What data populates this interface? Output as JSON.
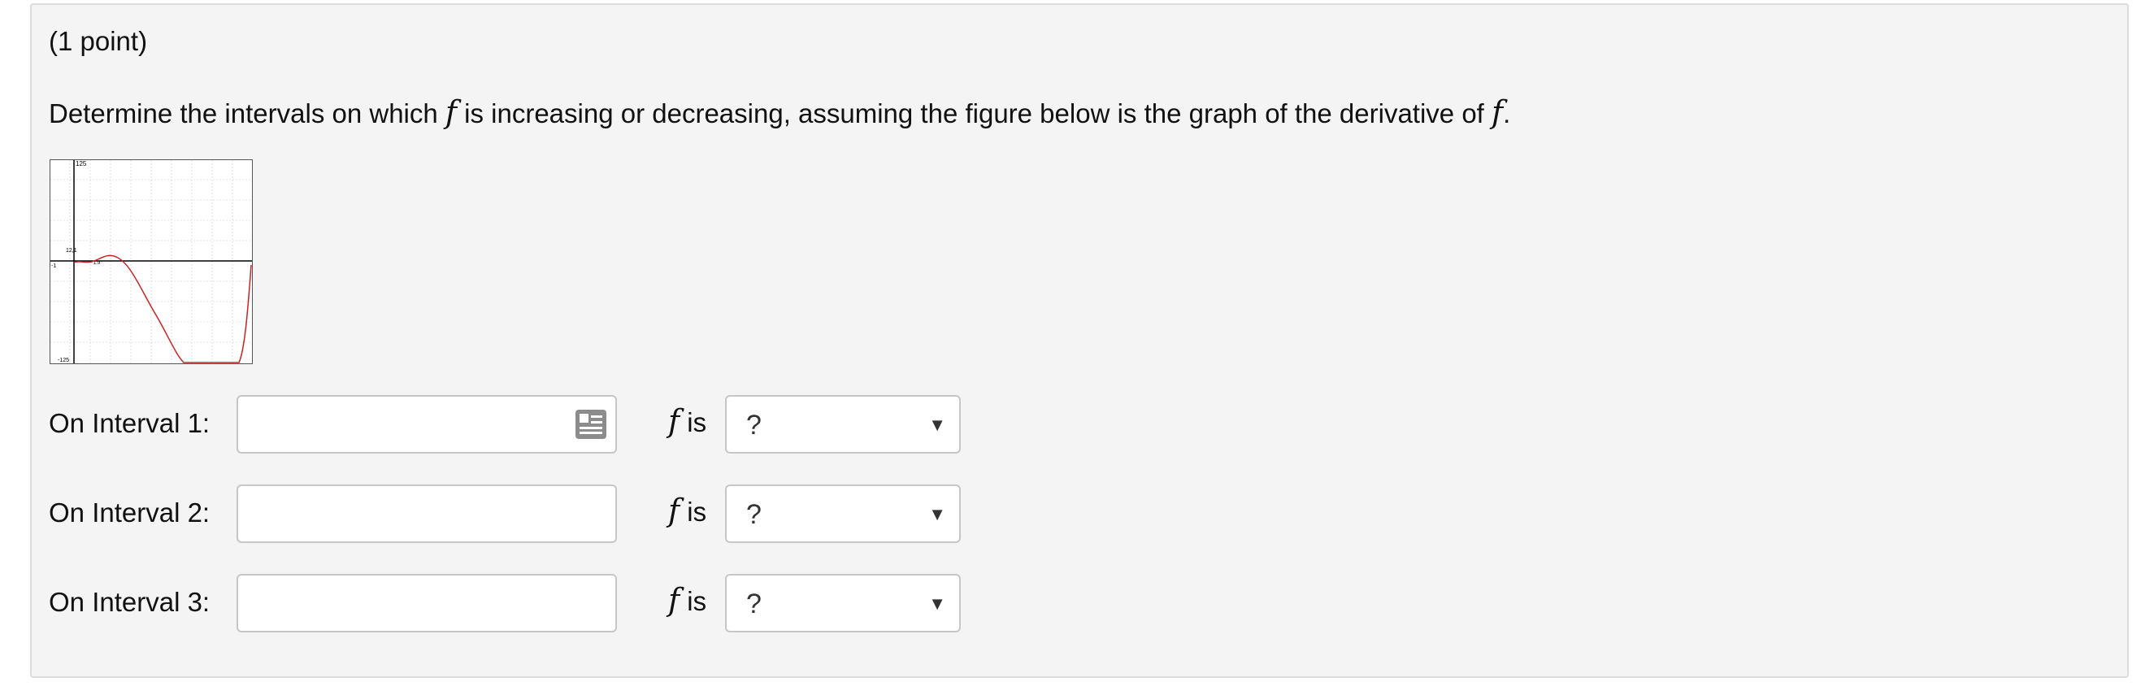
{
  "problem": {
    "points": "(1 point)",
    "question_prefix": "Determine the intervals on which ",
    "var": "f",
    "question_middle": " is increasing or decreasing, assuming the figure below is the graph of the derivative of ",
    "question_suffix": "."
  },
  "graph": {
    "y_max_label": "125",
    "y_min_label": "-125",
    "x_min_label": "-1",
    "point_label": "12,1",
    "tick_label": "1.9",
    "axis_color": "#000000",
    "grid_color": "#cccccc",
    "curve_color": "#cc2222"
  },
  "rows": [
    {
      "label": "On Interval 1:",
      "value": "",
      "fis_text": "is",
      "selected": "?"
    },
    {
      "label": "On Interval 2:",
      "value": "",
      "fis_text": "is",
      "selected": "?"
    },
    {
      "label": "On Interval 3:",
      "value": "",
      "fis_text": "is",
      "selected": "?"
    }
  ],
  "icons": {
    "equation_editor": "equation-editor-icon",
    "dropdown": "dropdown-arrow-icon"
  },
  "select_arrow": "▼"
}
